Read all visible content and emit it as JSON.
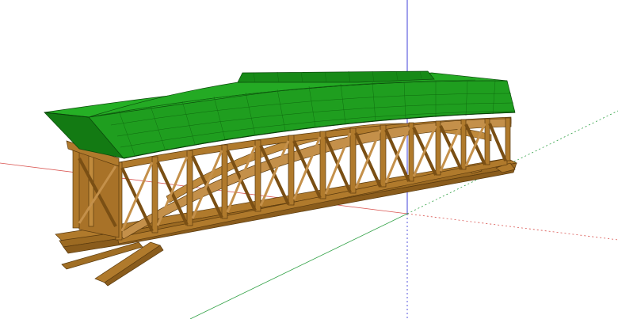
{
  "scene": {
    "background": "#ffffff",
    "axes": {
      "red": "#d9534f",
      "green": "#2ea043",
      "blue": "#2b2bd6"
    },
    "model": {
      "roof_color": "#1f9e1f",
      "roof_dark": "#137a13",
      "timber_color": "#b07a2c",
      "timber_dark": "#7a4f14",
      "timber_light": "#d09a48"
    }
  }
}
